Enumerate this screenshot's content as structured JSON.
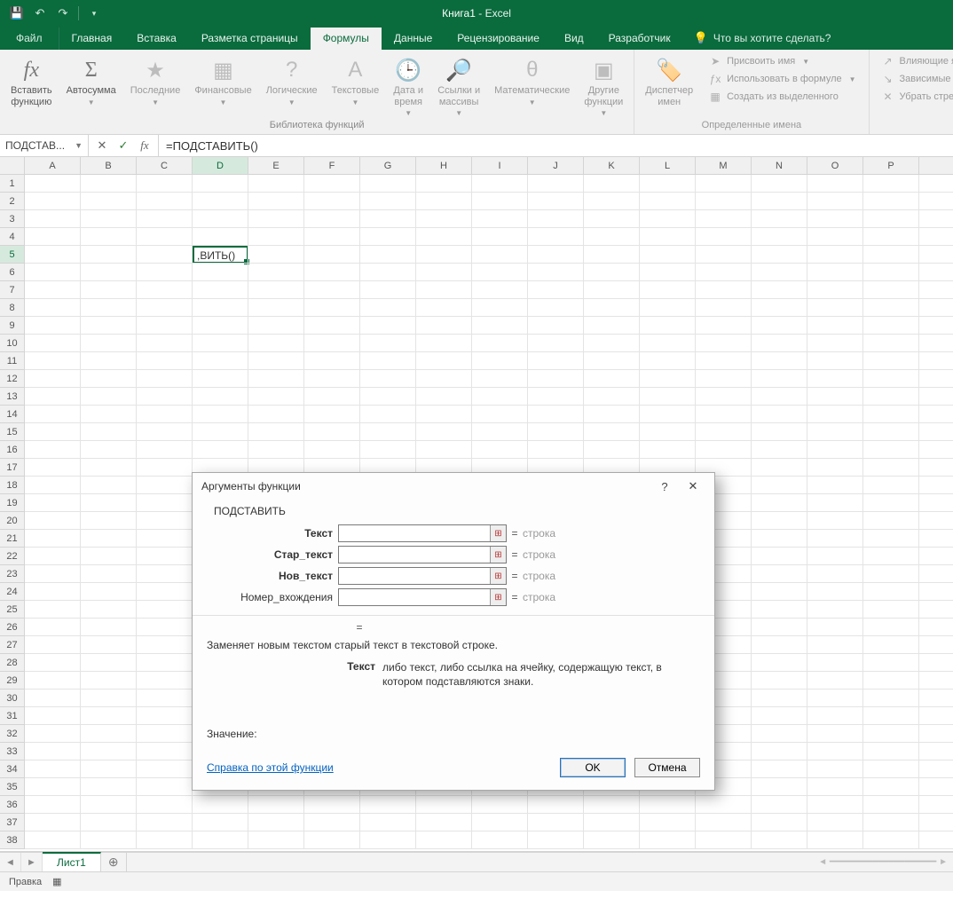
{
  "title": {
    "document": "Книга1",
    "app": "Excel"
  },
  "tabs": {
    "file": "Файл",
    "items": [
      "Главная",
      "Вставка",
      "Разметка страницы",
      "Формулы",
      "Данные",
      "Рецензирование",
      "Вид",
      "Разработчик"
    ],
    "active_index": 3,
    "tell_me": "Что вы хотите сделать?"
  },
  "ribbon": {
    "groups": {
      "library": {
        "label": "Библиотека функций",
        "insert_function": {
          "line1": "Вставить",
          "line2": "функцию"
        },
        "autosum": "Автосумма",
        "recent": "Последние",
        "financial": "Финансовые",
        "logical": "Логические",
        "text": "Текстовые",
        "datetime": {
          "line1": "Дата и",
          "line2": "время"
        },
        "lookup": {
          "line1": "Ссылки и",
          "line2": "массивы"
        },
        "math": "Математические",
        "more": {
          "line1": "Другие",
          "line2": "функции"
        }
      },
      "names": {
        "label": "Определенные имена",
        "manager": {
          "line1": "Диспетчер",
          "line2": "имен"
        },
        "define": "Присвоить имя",
        "usein": "Использовать в формуле",
        "create": "Создать из выделенного"
      },
      "audit": {
        "trace_prec": "Влияющие ячейки",
        "trace_dep": "Зависимые ячейки",
        "remove_arrows": "Убрать стрелки"
      }
    }
  },
  "formula_bar": {
    "name_box": "ПОДСТАВ...",
    "formula": "=ПОДСТАВИТЬ()"
  },
  "grid": {
    "columns": [
      "A",
      "B",
      "C",
      "D",
      "E",
      "F",
      "G",
      "H",
      "I",
      "J",
      "K",
      "L",
      "M",
      "N",
      "O",
      "P"
    ],
    "row_count": 38,
    "active_col": "D",
    "active_row": 5,
    "active_cell_display": ",ВИТЬ()"
  },
  "dialog": {
    "title": "Аргументы функции",
    "function_name": "ПОДСТАВИТЬ",
    "args": [
      {
        "label": "Текст",
        "bold": true,
        "value": "",
        "type": "строка"
      },
      {
        "label": "Стар_текст",
        "bold": true,
        "value": "",
        "type": "строка"
      },
      {
        "label": "Нов_текст",
        "bold": true,
        "value": "",
        "type": "строка"
      },
      {
        "label": "Номер_вхождения",
        "bold": false,
        "value": "",
        "type": "строка"
      }
    ],
    "description": "Заменяет новым текстом старый текст в текстовой строке.",
    "arg_detail_label": "Текст",
    "arg_detail_text": "либо текст, либо ссылка на ячейку, содержащую текст, в котором подставляются знаки.",
    "value_label": "Значение:",
    "help_link": "Справка по этой функции",
    "ok": "OK",
    "cancel": "Отмена"
  },
  "sheet_tabs": {
    "active": "Лист1"
  },
  "status_bar": {
    "mode": "Правка"
  }
}
